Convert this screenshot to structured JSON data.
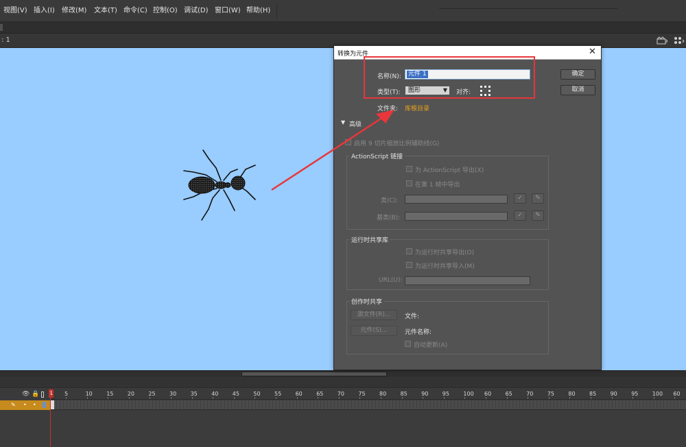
{
  "menubar": {
    "items": [
      {
        "label": "视图(V)"
      },
      {
        "label": "插入(I)"
      },
      {
        "label": "修改(M)"
      },
      {
        "label": "文本(T)"
      },
      {
        "label": "命令(C)"
      },
      {
        "label": "控制(O)"
      },
      {
        "label": "调试(D)"
      },
      {
        "label": "窗口(W)"
      },
      {
        "label": "帮助(H)"
      }
    ]
  },
  "edit_bar": {
    "scene_label": ": 1",
    "icons": [
      "scene-icon",
      "symbol-icon"
    ]
  },
  "stage": {
    "background": "#99ccff",
    "artwork": "ant"
  },
  "dialog": {
    "title": "转换为元件",
    "close_glyph": "✕",
    "name_label": "名称(N):",
    "name_value": "元件 1",
    "type_label": "类型(T):",
    "type_value": "图形",
    "align_label": "对齐:",
    "folder_label": "文件夹:",
    "folder_link": "库根目录",
    "ok_label": "确定",
    "cancel_label": "取消",
    "advanced_label": "高级",
    "scale9_label": "启用 9 切片缩放比例辅助线(G)",
    "as_group": {
      "title": "ActionScript 链接",
      "export_as_label": "为 ActionScript 导出(X)",
      "export_frame1_label": "在第 1 帧中导出",
      "class_label": "类(C):",
      "base_class_label": "基类(B):"
    },
    "runtime_group": {
      "title": "运行时共享库",
      "export_label": "为运行时共享导出(O)",
      "import_label": "为运行时共享导入(M)",
      "url_label": "URL(U):"
    },
    "authortime_group": {
      "title": "创作时共享",
      "source_file_button": "源文件(R)...",
      "file_label": "文件:",
      "symbol_button": "元件(S)...",
      "symbol_name_label": "元件名称:",
      "auto_update_label": "自动更新(A)"
    }
  },
  "timeline": {
    "current_frame": "1",
    "ruler": [
      "5",
      "10",
      "15",
      "20",
      "25",
      "30",
      "35",
      "40",
      "45",
      "50",
      "55",
      "60",
      "65",
      "70",
      "75",
      "80",
      "85",
      "90",
      "95",
      "100",
      "60",
      "65",
      "70",
      "75",
      "80",
      "85",
      "90",
      "95",
      "100",
      "60"
    ]
  },
  "annotations": {
    "highlight_color": "#e8363b"
  }
}
